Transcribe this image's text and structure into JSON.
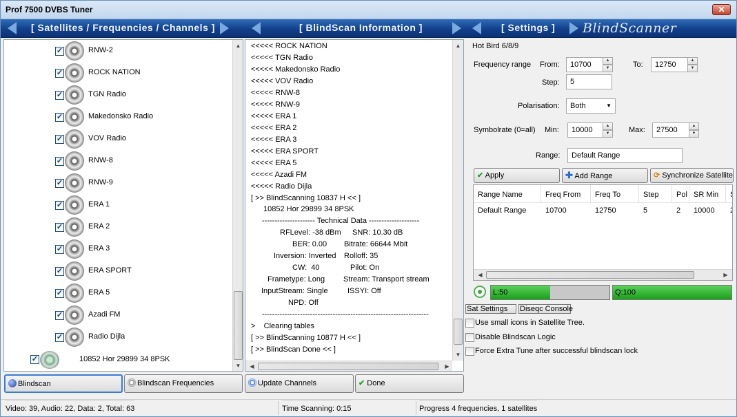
{
  "window": {
    "title": "Prof 7500 DVBS Tuner"
  },
  "headers": {
    "left": "[ Satellites / Frequencies / Channels ]",
    "middle": "[ BlindScan Information ]",
    "settings": "[ Settings ]",
    "brand": "BlindScanner"
  },
  "tree": {
    "channels": [
      "RNW-2",
      "ROCK NATION",
      "TGN Radio",
      "Makedonsko Radio",
      "VOV Radio",
      "RNW-8",
      "RNW-9",
      "ERA 1",
      "ERA 2",
      "ERA 3",
      "ERA SPORT",
      "ERA 5",
      "Azadi FM",
      "Radio Dijla"
    ],
    "frequency": "10852 Hor 29899 34 8PSK"
  },
  "log": {
    "lines": [
      "<<<<< ROCK NATION",
      "<<<<< TGN Radio",
      "<<<<< Makedonsko Radio",
      "<<<<< VOV Radio",
      "<<<<< RNW-8",
      "<<<<< RNW-9",
      "<<<<< ERA 1",
      "<<<<< ERA 2",
      "<<<<< ERA 3",
      "<<<<< ERA SPORT",
      "<<<<< ERA 5",
      "<<<<< Azadi FM",
      "<<<<< Radio Dijla",
      "[ >> BlindScanning 10837 H << ]"
    ],
    "found": "10852 Hor 29899 34 8PSK",
    "tech_header": "--------------------- Technical Data --------------------",
    "rflevel": "RFLevel: -38 dBm",
    "snr": "SNR: 10.30 dB",
    "ber": "BER: 0.00",
    "bitrate": "Bitrate: 66644 Mbit",
    "inversion": "Inversion: Inverted",
    "rolloff": "Rolloff: 35",
    "cw": "CW:  40",
    "pilot": "Pilot: On",
    "frametype": "Frametype: Long",
    "stream": "Stream: Transport stream",
    "inputstream": "InputStream: Single",
    "issyi": "ISSYI: Off",
    "npd": "NPD: Off",
    "divider": "------------------------------------------------------------------",
    "clearing": ">    Clearing tables",
    "scan2": "[ >> BlindScanning 10877 H << ]",
    "done": "[ >> BlindScan Done << ]"
  },
  "settings": {
    "satellite": "Hot Bird 6/8/9",
    "freq_range_label": "Frequency range",
    "from_label": "From:",
    "from_value": "10700",
    "to_label": "To:",
    "to_value": "12750",
    "step_label": "Step:",
    "step_value": "5",
    "polarisation_label": "Polarisation:",
    "polarisation_value": "Both",
    "symbolrate_label": "Symbolrate (0=all)",
    "min_label": "Min:",
    "min_value": "10000",
    "max_label": "Max:",
    "max_value": "27500",
    "range_label": "Range:",
    "range_value": "Default Range",
    "apply": "Apply",
    "add_range": "Add Range",
    "sync": "Synchronize Satellite",
    "columns": [
      "Range Name",
      "Freq From",
      "Freq To",
      "Step",
      "Pol",
      "SR Min",
      "S"
    ],
    "rows": [
      [
        "Default Range",
        "10700",
        "12750",
        "5",
        "2",
        "10000",
        "2"
      ]
    ],
    "level": "L:50",
    "quality": "Q:100",
    "level_fraction": 0.5,
    "quality_fraction": 1.0,
    "tab_sat": "Sat Settings",
    "tab_diseqc": "Diseqc Console",
    "opt_small_icons": "Use small icons in Satellite Tree.",
    "opt_disable_logic": "Disable Blindscan Logic",
    "opt_force_tune": "Force Extra Tune after successful blindscan lock"
  },
  "buttons": {
    "blindscan": "Blindscan",
    "frequencies": "Blindscan Frequencies",
    "update": "Update Channels",
    "done": "Done"
  },
  "status": {
    "counts": "Video: 39, Audio: 22, Data: 2, Total: 63",
    "time": "Time Scanning: 0:15",
    "progress": "Progress 4 frequencies, 1 satellites"
  }
}
